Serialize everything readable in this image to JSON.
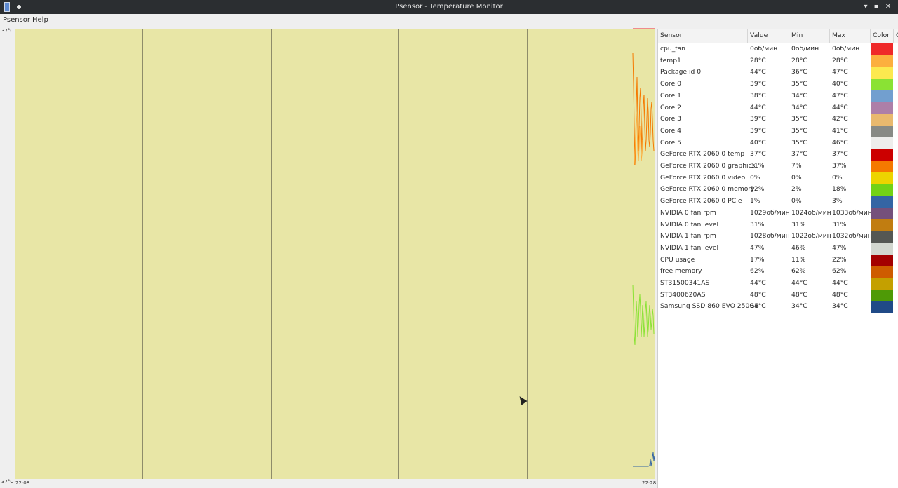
{
  "window": {
    "title": "Psensor - Temperature Monitor",
    "minimize": "▾",
    "maximize": "▪",
    "close": "✕"
  },
  "menu": {
    "psensor": "Psensor",
    "help": "Help"
  },
  "graph": {
    "y_max_label": "37°C",
    "y_min_label": "37°C",
    "x_start_label": "22:08",
    "x_end_label": "22:28",
    "background": "#e8e6a6"
  },
  "table": {
    "headers": [
      "Sensor",
      "Value",
      "Min",
      "Max",
      "Color",
      "G"
    ],
    "rows": [
      {
        "sensor": "cpu_fan",
        "value": "0об/мин",
        "min": "0об/мин",
        "max": "0об/мин",
        "color": "#ef2929"
      },
      {
        "sensor": "temp1",
        "value": "28°C",
        "min": "28°C",
        "max": "28°C",
        "color": "#fcaf3e"
      },
      {
        "sensor": "Package id 0",
        "value": "44°C",
        "min": "36°C",
        "max": "47°C",
        "color": "#fce94f"
      },
      {
        "sensor": "Core 0",
        "value": "39°C",
        "min": "35°C",
        "max": "40°C",
        "color": "#8ae234"
      },
      {
        "sensor": "Core 1",
        "value": "38°C",
        "min": "34°C",
        "max": "47°C",
        "color": "#729fcf"
      },
      {
        "sensor": "Core 2",
        "value": "44°C",
        "min": "34°C",
        "max": "44°C",
        "color": "#ad7fa8"
      },
      {
        "sensor": "Core 3",
        "value": "39°C",
        "min": "35°C",
        "max": "42°C",
        "color": "#e9b96e"
      },
      {
        "sensor": "Core 4",
        "value": "39°C",
        "min": "35°C",
        "max": "41°C",
        "color": "#888a85"
      },
      {
        "sensor": "Core 5",
        "value": "40°C",
        "min": "35°C",
        "max": "46°C",
        "color": "#eeeeec"
      },
      {
        "sensor": "GeForce RTX 2060 0 temp",
        "value": "37°C",
        "min": "37°C",
        "max": "37°C",
        "color": "#cc0000"
      },
      {
        "sensor": "GeForce RTX 2060 0 graphics",
        "value": "31%",
        "min": "7%",
        "max": "37%",
        "color": "#f57900"
      },
      {
        "sensor": "GeForce RTX 2060 0 video",
        "value": "0%",
        "min": "0%",
        "max": "0%",
        "color": "#edd400"
      },
      {
        "sensor": "GeForce RTX 2060 0 memory",
        "value": "12%",
        "min": "2%",
        "max": "18%",
        "color": "#73d216"
      },
      {
        "sensor": "GeForce RTX 2060 0 PCIe",
        "value": "1%",
        "min": "0%",
        "max": "3%",
        "color": "#3465a4"
      },
      {
        "sensor": "NVIDIA 0 fan rpm",
        "value": "1029об/мин",
        "min": "1024об/мин",
        "max": "1033об/мин",
        "color": "#75507b"
      },
      {
        "sensor": "NVIDIA 0 fan level",
        "value": "31%",
        "min": "31%",
        "max": "31%",
        "color": "#c17d11"
      },
      {
        "sensor": "NVIDIA 1 fan rpm",
        "value": "1028об/мин",
        "min": "1022об/мин",
        "max": "1032об/мин",
        "color": "#555753"
      },
      {
        "sensor": "NVIDIA 1 fan level",
        "value": "47%",
        "min": "46%",
        "max": "47%",
        "color": "#d3d7cf"
      },
      {
        "sensor": "CPU usage",
        "value": "17%",
        "min": "11%",
        "max": "22%",
        "color": "#a40000"
      },
      {
        "sensor": "free memory",
        "value": "62%",
        "min": "62%",
        "max": "62%",
        "color": "#ce5c00"
      },
      {
        "sensor": "ST31500341AS",
        "value": "44°C",
        "min": "44°C",
        "max": "44°C",
        "color": "#c4a000"
      },
      {
        "sensor": "ST3400620AS",
        "value": "48°C",
        "min": "48°C",
        "max": "48°C",
        "color": "#4e9a06"
      },
      {
        "sensor": "Samsung SSD 860 EVO 250GB",
        "value": "34°C",
        "min": "34°C",
        "max": "34°C",
        "color": "#204a87"
      }
    ]
  }
}
